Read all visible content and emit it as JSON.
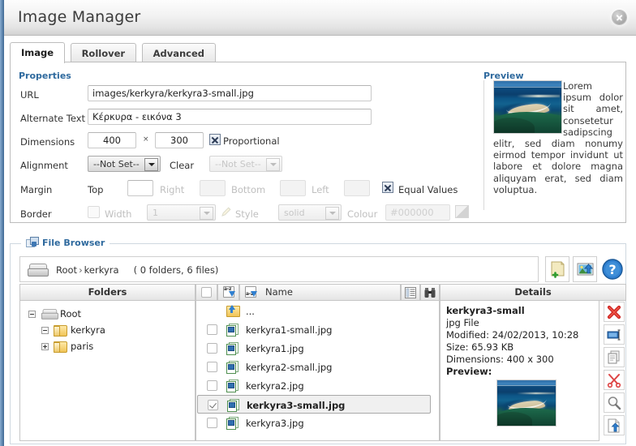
{
  "window": {
    "title": "Image Manager",
    "close_icon": "close-icon"
  },
  "tabs": [
    {
      "label": "Image",
      "active": true
    },
    {
      "label": "Rollover",
      "active": false
    },
    {
      "label": "Advanced",
      "active": false
    }
  ],
  "properties": {
    "section_title": "Properties",
    "url": {
      "label": "URL",
      "value": "images/kerkyra/kerkyra3-small.jpg"
    },
    "alternate_text": {
      "label": "Alternate Text",
      "value": "Κέρκυρα - εικόνα 3"
    },
    "dimensions": {
      "label": "Dimensions",
      "width": "400",
      "separator": "×",
      "height": "300",
      "proportional_label": "Proportional",
      "proportional_checked": true
    },
    "alignment": {
      "label": "Alignment",
      "value": "--Not Set--",
      "clear_label": "Clear",
      "clear_value": "--Not Set--"
    },
    "margin": {
      "label": "Margin",
      "top_label": "Top",
      "top_value": "",
      "right_label": "Right",
      "right_value": "",
      "bottom_label": "Bottom",
      "bottom_value": "",
      "left_label": "Left",
      "left_value": "",
      "equal_values_label": "Equal Values",
      "equal_values_checked": true
    },
    "border": {
      "label": "Border",
      "enabled": false,
      "width_label": "Width",
      "width_value": "1",
      "style_label": "Style",
      "style_value": "solid",
      "colour_label": "Colour",
      "colour_value": "#000000",
      "colour_swatch": "#000000"
    }
  },
  "preview": {
    "section_title": "Preview",
    "image_alt": "beach-thumbnail",
    "text": "Lorem ipsum dolor sit amet, consetetur sadipscing elitr, sed diam nonumy eirmod tempor invidunt ut labore et dolore magna aliquyam erat, sed diam voluptua."
  },
  "file_browser": {
    "legend": "File Browser",
    "path": {
      "root": "Root",
      "separator": "›",
      "current": "kerkyra",
      "count": "( 0 folders, 6 files)"
    },
    "toolbar": [
      {
        "name": "new-folder-button",
        "icon": "new-folder-icon"
      },
      {
        "name": "upload-button",
        "icon": "upload-image-icon"
      },
      {
        "name": "help-button",
        "icon": "help-icon"
      }
    ],
    "columns": {
      "folders": "Folders",
      "name": "Name",
      "details": "Details"
    },
    "folder_tree": [
      {
        "label": "Root",
        "level": 0,
        "state": "minus",
        "icon": "drive-icon"
      },
      {
        "label": "kerkyra",
        "level": 1,
        "state": "minus",
        "icon": "folder-icon"
      },
      {
        "label": "paris",
        "level": 1,
        "state": "plus",
        "icon": "folder-icon"
      }
    ],
    "files": [
      {
        "name": "...",
        "icon": "folder-up-icon",
        "checkbox": false,
        "selected": false,
        "parent": true
      },
      {
        "name": "kerkyra1-small.jpg",
        "icon": "image-file-icon",
        "checked": false,
        "selected": false
      },
      {
        "name": "kerkyra1.jpg",
        "icon": "image-file-icon",
        "checked": false,
        "selected": false
      },
      {
        "name": "kerkyra2-small.jpg",
        "icon": "image-file-icon",
        "checked": false,
        "selected": false
      },
      {
        "name": "kerkyra2.jpg",
        "icon": "image-file-icon",
        "checked": false,
        "selected": false
      },
      {
        "name": "kerkyra3-small.jpg",
        "icon": "image-file-icon",
        "checked": true,
        "selected": true
      },
      {
        "name": "kerkyra3.jpg",
        "icon": "image-file-icon",
        "checked": false,
        "selected": false
      }
    ],
    "details": {
      "title": "kerkyra3-small",
      "type": "jpg File",
      "modified": "Modified: 24/02/2013, 10:28",
      "size": "Size: 65.93 KB",
      "dimensions": "Dimensions: 400 x 300",
      "preview_label": "Preview:",
      "preview_alt": "beach-thumbnail"
    },
    "side_buttons": [
      {
        "name": "delete-button",
        "icon": "red-x-icon"
      },
      {
        "name": "rename-button",
        "icon": "rename-icon"
      },
      {
        "name": "copy-button",
        "icon": "copy-icon"
      },
      {
        "name": "cut-button",
        "icon": "scissors-icon"
      },
      {
        "name": "zoom-button",
        "icon": "magnifier-icon"
      },
      {
        "name": "insert-button",
        "icon": "insert-file-icon"
      }
    ]
  },
  "colors": {
    "accent_blue": "#2f6a9e",
    "rail": "#4d7aa8",
    "selected_row": "#f0f0f0"
  }
}
